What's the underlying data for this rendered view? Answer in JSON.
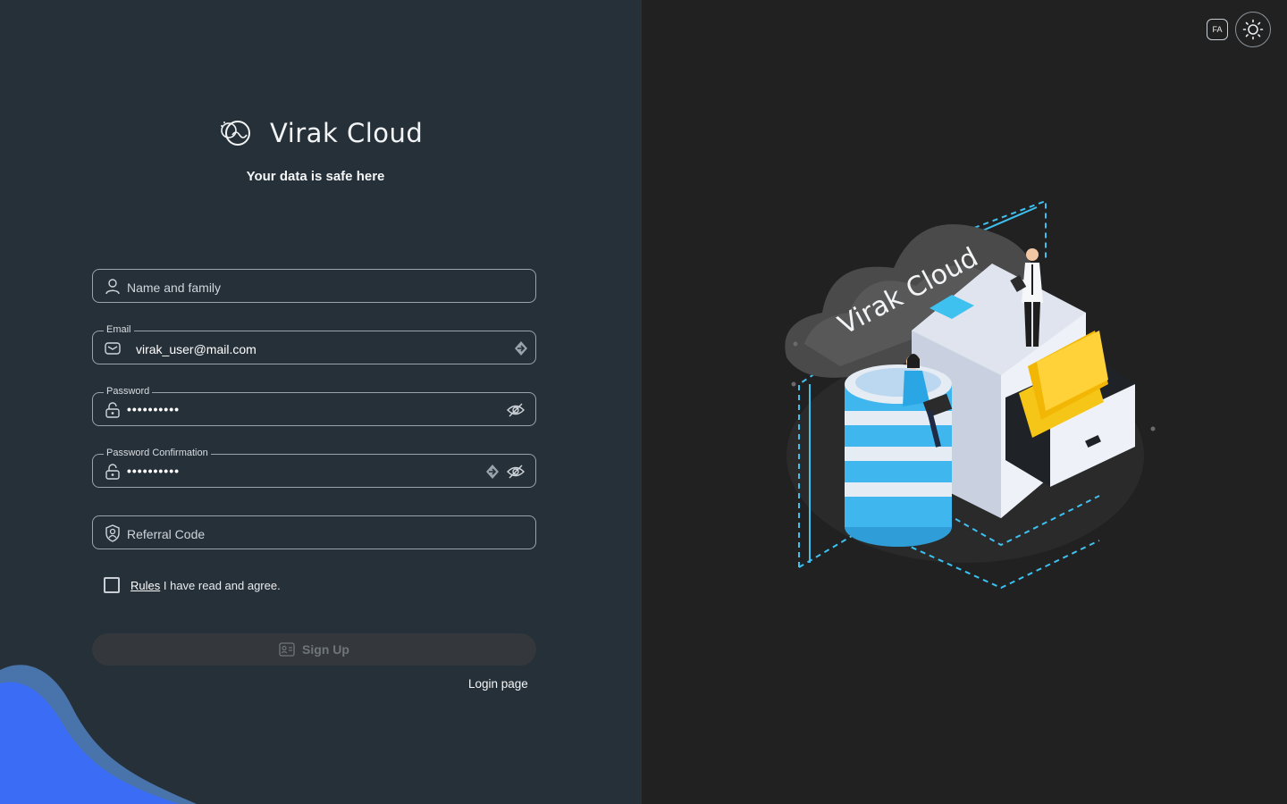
{
  "brand": {
    "name": "Virak Cloud",
    "tagline": "Your data is safe here"
  },
  "form": {
    "name": {
      "placeholder": "Name and family"
    },
    "email": {
      "label": "Email",
      "value": "virak_user@mail.com"
    },
    "password": {
      "label": "Password",
      "value": "••••••••••"
    },
    "password_confirmation": {
      "label": "Password Confirmation",
      "value": "••••••••••"
    },
    "referral": {
      "placeholder": "Referral Code"
    },
    "agree": {
      "rules_link": "Rules",
      "text": "I have read and agree."
    },
    "signup_label": "Sign Up",
    "login_link": "Login page"
  },
  "topbar": {
    "lang_label": "FA"
  },
  "illustration": {
    "label": "Virak Cloud"
  },
  "colors": {
    "left_bg": "#263039",
    "right_bg": "#212121",
    "accent_wave": "#3b6cf6",
    "illus_blue": "#2fb4f0",
    "folder_yellow": "#f5c518"
  }
}
